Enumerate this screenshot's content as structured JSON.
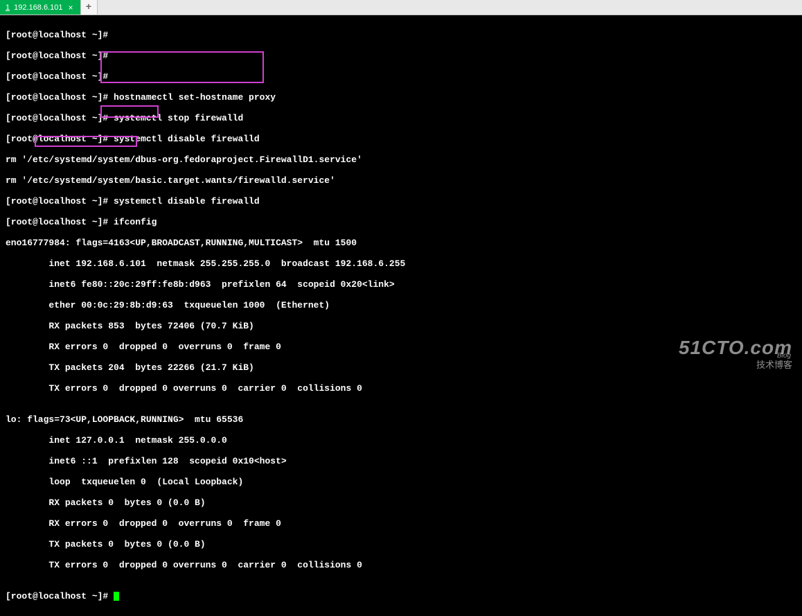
{
  "tab": {
    "index": "1",
    "title": "192.168.6.101",
    "close": "×",
    "add": "+"
  },
  "prompt": "[root@localhost ~]# ",
  "lines": {
    "l1": "[root@localhost ~]# ",
    "l2": "[root@localhost ~]# ",
    "l3": "[root@localhost ~]# ",
    "l4": "[root@localhost ~]# hostnamectl set-hostname proxy",
    "l5": "[root@localhost ~]# systemctl stop firewalld",
    "l6": "[root@localhost ~]# systemctl disable firewalld",
    "l7": "rm '/etc/systemd/system/dbus-org.fedoraproject.FirewallD1.service'",
    "l8": "rm '/etc/systemd/system/basic.target.wants/firewalld.service'",
    "l9": "[root@localhost ~]# systemctl disable firewalld",
    "l10": "[root@localhost ~]# ifconfig",
    "l11": "eno16777984: flags=4163<UP,BROADCAST,RUNNING,MULTICAST>  mtu 1500",
    "l12": "        inet 192.168.6.101  netmask 255.255.255.0  broadcast 192.168.6.255",
    "l13": "        inet6 fe80::20c:29ff:fe8b:d963  prefixlen 64  scopeid 0x20<link>",
    "l14": "        ether 00:0c:29:8b:d9:63  txqueuelen 1000  (Ethernet)",
    "l15": "        RX packets 853  bytes 72406 (70.7 KiB)",
    "l16": "        RX errors 0  dropped 0  overruns 0  frame 0",
    "l17": "        TX packets 204  bytes 22266 (21.7 KiB)",
    "l18": "        TX errors 0  dropped 0 overruns 0  carrier 0  collisions 0",
    "l19": "",
    "l20": "lo: flags=73<UP,LOOPBACK,RUNNING>  mtu 65536",
    "l21": "        inet 127.0.0.1  netmask 255.0.0.0",
    "l22": "        inet6 ::1  prefixlen 128  scopeid 0x10<host>",
    "l23": "        loop  txqueuelen 0  (Local Loopback)",
    "l24": "        RX packets 0  bytes 0 (0.0 B)",
    "l25": "        RX errors 0  dropped 0  overruns 0  frame 0",
    "l26": "        TX packets 0  bytes 0 (0.0 B)",
    "l27": "        TX errors 0  dropped 0 overruns 0  carrier 0  collisions 0",
    "l28": "",
    "l29": "[root@localhost ~]# "
  },
  "watermark": {
    "main": "51CTO.com",
    "sub": "技术博客",
    "blog": "Blog"
  }
}
